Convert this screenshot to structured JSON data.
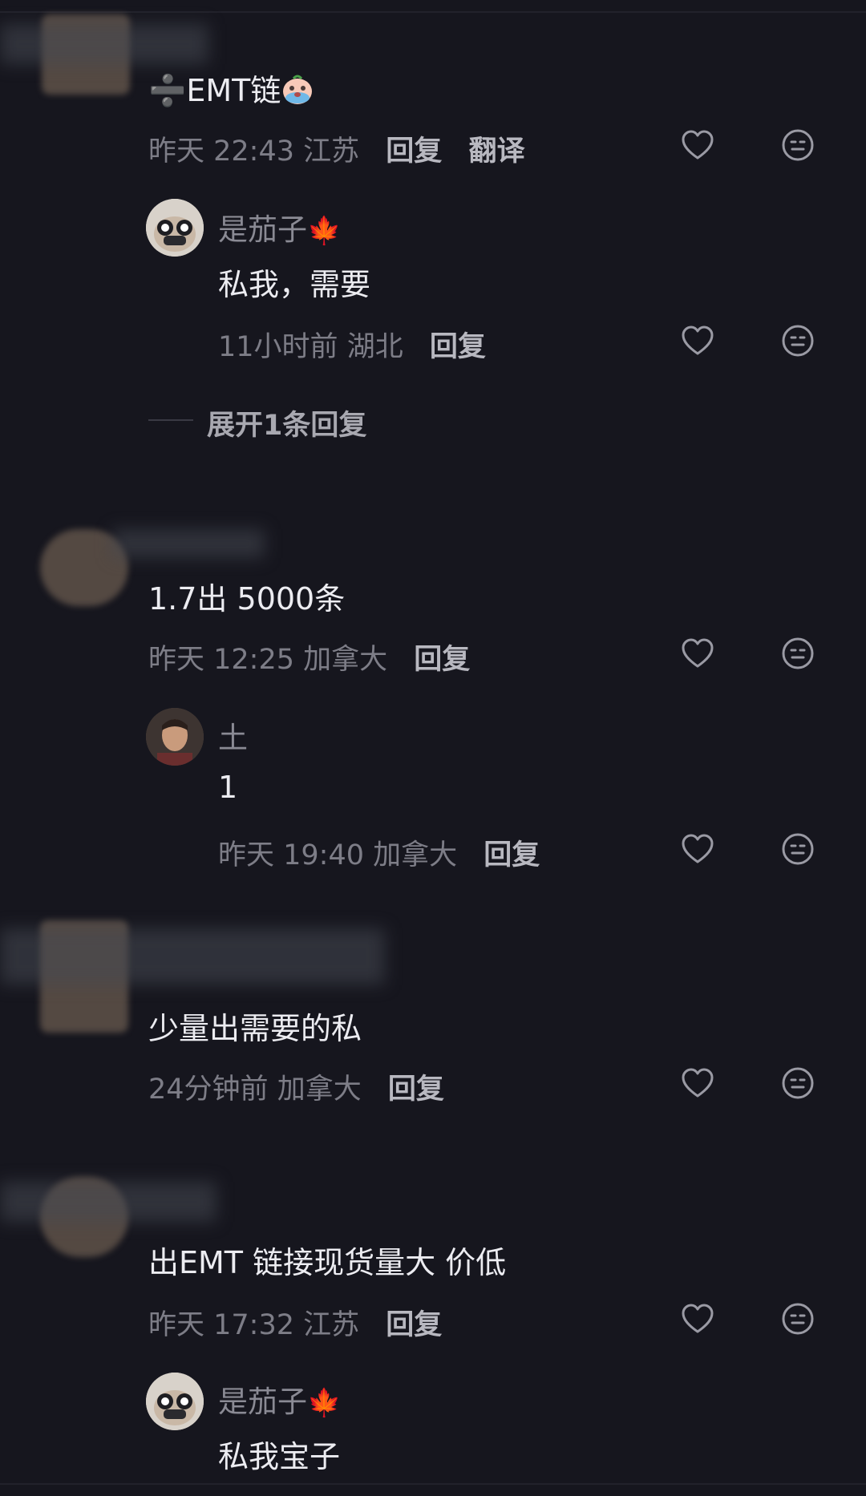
{
  "comments": [
    {
      "text": "➗EMT链",
      "time": "昨天 22:43",
      "location": "江苏",
      "reply_label": "回复",
      "translate_label": "翻译",
      "replies": [
        {
          "username": "是茄子",
          "username_emoji": "🍁",
          "text": "私我，需要",
          "time": "11小时前",
          "location": "湖北",
          "reply_label": "回复"
        }
      ],
      "expand_label": "展开1条回复"
    },
    {
      "text": "1.7出 5000条",
      "time": "昨天 12:25",
      "location": "加拿大",
      "reply_label": "回复",
      "replies": [
        {
          "username": "土",
          "text": "1",
          "time": "昨天 19:40",
          "location": "加拿大",
          "reply_label": "回复"
        }
      ]
    },
    {
      "text": "少量出需要的私",
      "time": "24分钟前",
      "location": "加拿大",
      "reply_label": "回复"
    },
    {
      "text": "出EMT  链接现货量大 价低",
      "time": "昨天 17:32",
      "location": "江苏",
      "reply_label": "回复",
      "replies": [
        {
          "username": "是茄子",
          "username_emoji": "🍁",
          "text": "私我宝子"
        }
      ]
    }
  ],
  "icons": {
    "like": "heart-outline-icon",
    "dislike": "neutral-face-icon"
  },
  "colors": {
    "background": "#16161e",
    "primary_text": "#ececf1",
    "meta_text": "#7d7d87",
    "action_text": "#b8b8c0",
    "maple": "#e2452b"
  }
}
